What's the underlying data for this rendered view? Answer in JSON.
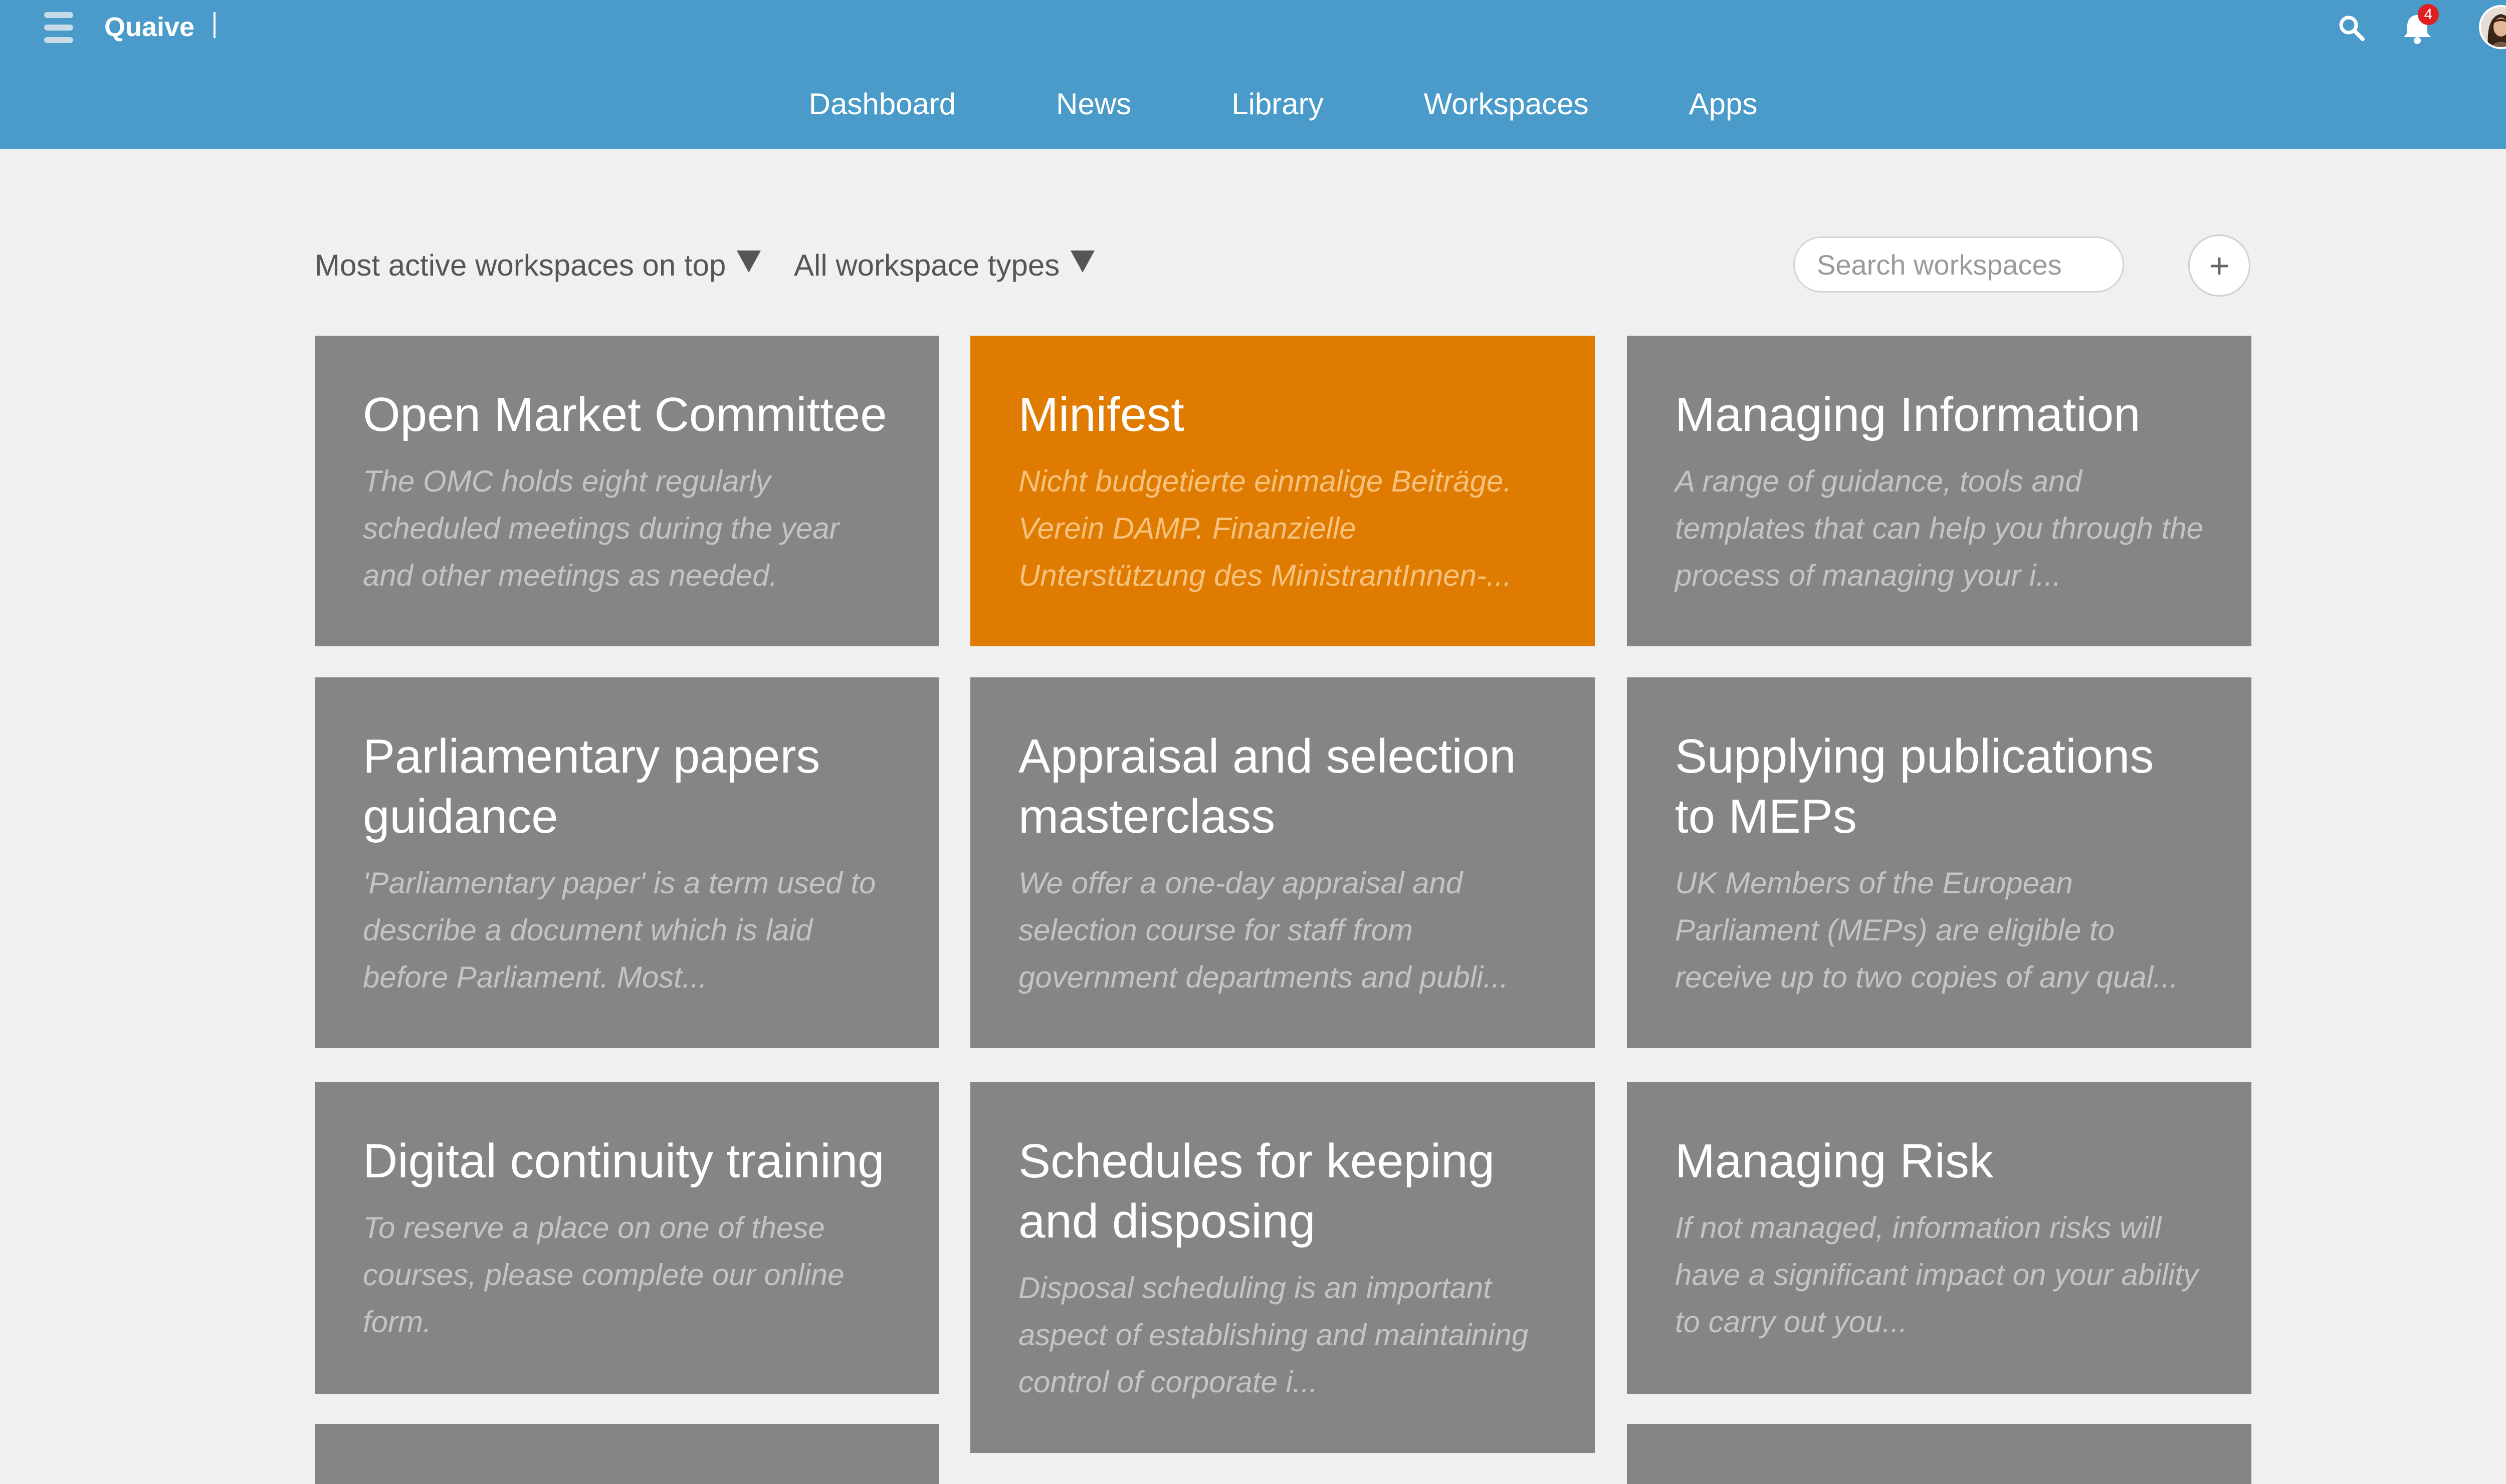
{
  "header": {
    "brand": "Quaive",
    "notification_count": "4",
    "icons": {
      "menu": "hamburger-menu-icon",
      "search": "search-icon",
      "notifications": "bell-icon",
      "avatar": "user-avatar"
    }
  },
  "nav": {
    "items": [
      {
        "label": "Dashboard"
      },
      {
        "label": "News"
      },
      {
        "label": "Library"
      },
      {
        "label": "Workspaces"
      },
      {
        "label": "Apps"
      }
    ]
  },
  "toolbar": {
    "sort_label": "Most active workspaces on top",
    "type_label": "All workspace types",
    "search_placeholder": "Search workspaces",
    "add_label": "+"
  },
  "colors": {
    "header": "#4a9bc9",
    "tile": "#858585",
    "tile_active": "#df7b00",
    "background": "#f0f0f0"
  },
  "workspaces": [
    {
      "title": "Open Market Committee",
      "description": "The OMC holds eight regularly scheduled meetings during the year and other meetings as needed."
    },
    {
      "title": "Minifest",
      "description": "Nicht budgetierte einmalige Beiträge. Verein DAMP. Finanzielle Unterstützung des MinistrantInnen-...",
      "active": true
    },
    {
      "title": "Managing Information",
      "description": "A range of guidance, tools and templates that can help you through the process of managing your i..."
    },
    {
      "title": "Parliamentary papers guidance",
      "description": "'Parliamentary paper' is a term used to describe a document which is laid before Parliament. Most..."
    },
    {
      "title": "Appraisal and selection masterclass",
      "description": "We offer a one-day appraisal and selection course for staff from government departments and publi..."
    },
    {
      "title": "Supplying publications to MEPs",
      "description": "UK Members of the European Parliament (MEPs) are eligible to receive up to two copies of any qual..."
    },
    {
      "title": "Digital continuity training",
      "description": "To reserve a place on one of these courses, please complete our online form."
    },
    {
      "title": "Schedules for keeping and disposing",
      "description": "Disposal scheduling is an important aspect of establishing and maintaining control of corporate i..."
    },
    {
      "title": "Managing Risk",
      "description": "If not managed, information risks will have a significant impact on your ability to carry out you..."
    }
  ]
}
